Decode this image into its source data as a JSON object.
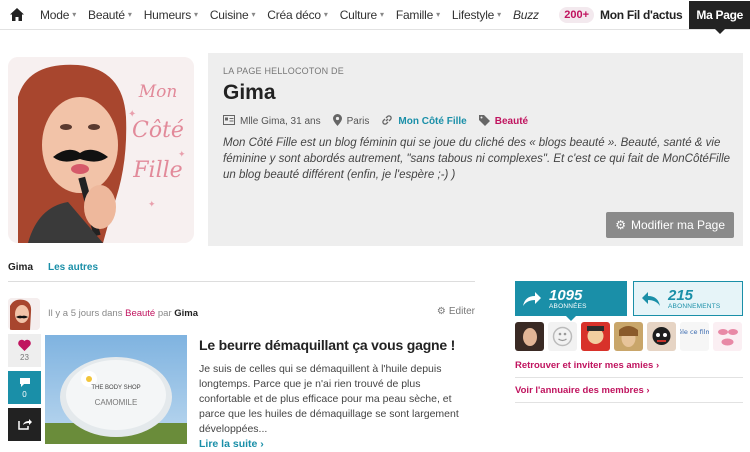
{
  "nav": {
    "items": [
      {
        "label": "Mode",
        "caret": true
      },
      {
        "label": "Beauté",
        "caret": true
      },
      {
        "label": "Humeurs",
        "caret": true
      },
      {
        "label": "Cuisine",
        "caret": true
      },
      {
        "label": "Créa déco",
        "caret": true
      },
      {
        "label": "Culture",
        "caret": true
      },
      {
        "label": "Famille",
        "caret": true
      },
      {
        "label": "Lifestyle",
        "caret": true
      },
      {
        "label": "Buzz",
        "caret": false
      }
    ],
    "count_badge": "200+",
    "fil_actus": "Mon Fil d'actus",
    "ma_page": "Ma Page"
  },
  "avatar": {
    "text_line1": "Mon",
    "text_line2": "Côté",
    "text_line3": "Fille"
  },
  "profile": {
    "label": "LA PAGE HELLOCOTON DE",
    "name": "Gima",
    "meta_person": "Mlle Gima, 31 ans",
    "meta_city": "Paris",
    "meta_blog": "Mon Côté Fille",
    "meta_tag": "Beauté",
    "description": "Mon Côté Fille est un blog féminin qui se joue du cliché des « blogs beauté ». Beauté, santé & vie féminine y sont abordés autrement, \"sans tabous ni complexes\". Et c'est ce qui fait de MonCôtéFille un blog beauté différent (enfin, je l'espère ;-) )",
    "edit_button": "Modifier ma Page"
  },
  "tabs": {
    "active": "Gima",
    "other": "Les autres"
  },
  "post": {
    "meta_prefix": "Il y a 5 jours dans",
    "meta_category": "Beauté",
    "meta_by": "par",
    "meta_author": "Gima",
    "edit": "Editer",
    "likes": "23",
    "comments": "0",
    "title": "Le beurre démaquillant ça vous gagne !",
    "excerpt": "Je suis de celles qui se démaquillent à l'huile depuis longtemps. Parce que je n'ai rien trouvé de plus confortable et de plus efficace pour ma peau sèche, et parce que les huiles de démaquillage se sont largement développées...",
    "read_more": "Lire la suite ›",
    "image_brand": "THE BODY SHOP",
    "image_product": "CAMOMILE"
  },
  "follow": {
    "followers_count": "1095",
    "followers_label": "ABONNÉES",
    "following_count": "215",
    "following_label": "ABONNEMENTS"
  },
  "friend_tile_text": "Mêle ce film !",
  "links": {
    "invite": "Retrouver et inviter mes amies ›",
    "directory": "Voir l'annuaire des membres ›"
  },
  "colors": {
    "accent_pink": "#c0145f",
    "accent_teal": "#1a8fa8"
  }
}
